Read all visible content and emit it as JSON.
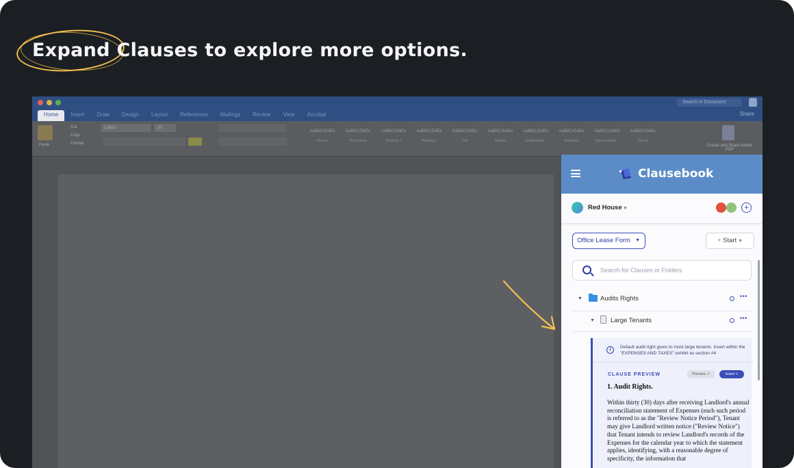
{
  "headline": {
    "highlight": "Expand",
    "rest": "Clauses to explore more options."
  },
  "colors": {
    "background": "#1b1e22",
    "highlight_oval": "#f2c14e",
    "panel_header": "#5b8cc8",
    "accent": "#3b4db8"
  },
  "word": {
    "search_placeholder": "Search in Document",
    "share": "Share",
    "tabs": [
      "Home",
      "Insert",
      "Draw",
      "Design",
      "Layout",
      "References",
      "Mailings",
      "Review",
      "View",
      "Acrobat"
    ],
    "clipboard": {
      "paste": "Paste",
      "cut": "Cut",
      "copy": "Copy",
      "format": "Format"
    },
    "font_name": "Calibri",
    "font_size": "20",
    "styles": [
      "Normal",
      "No Spacing",
      "Heading 1",
      "Heading 2",
      "Title",
      "Subtitle",
      "Subtle Emph...",
      "Emphasis",
      "Intense Emph...",
      "Strong"
    ],
    "style_sample": "AaBbCcDdEe",
    "create_pdf": "Create and Share Adobe PDF"
  },
  "panel": {
    "brand": "Clausebook",
    "workspace": "Red House",
    "form_select": "Office Lease Form",
    "start_button": "Start",
    "search_placeholder": "Search for Clauses or Folders",
    "tree": [
      {
        "label": "Audits Rights",
        "type": "folder"
      },
      {
        "label": "Large Tenants",
        "type": "clause"
      }
    ],
    "clause": {
      "description": "Default audit right given to most large tenants. Insert within the \"EXPENSES AND TAXES\" exhibit as section #4",
      "preview_label": "CLAUSE PREVIEW",
      "preview_button": "Preview",
      "insert_button": "Insert",
      "title": "1. Audit Rights.",
      "body": "Within thirty (30) days after receiving Landlord's annual reconciliation statement of Expenses  (each such period is referred to as the \"Review Notice Period\"), Tenant may give Landlord written notice (\"Review Notice\") that Tenant intends to review Landlord's records of the Expenses for the calendar year to which the statement applies, identifying, with a reasonable degree of specificity, the information that"
    }
  }
}
